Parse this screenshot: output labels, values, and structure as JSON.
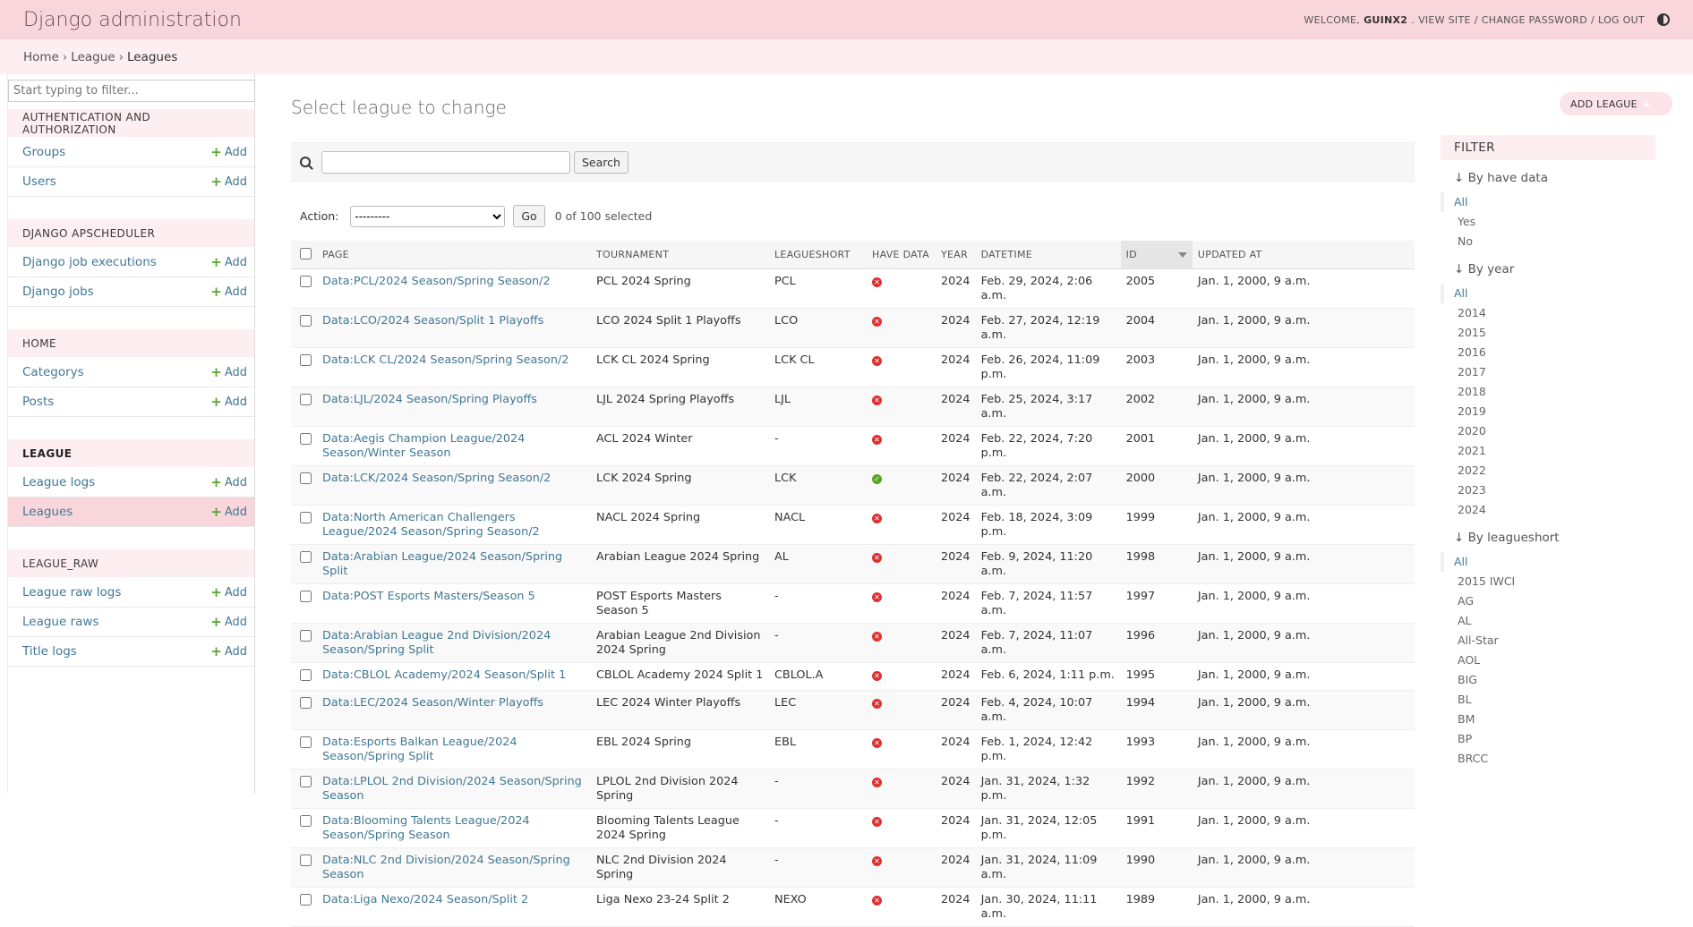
{
  "header": {
    "site_name": "Django administration",
    "welcome": "WELCOME,",
    "username": "GUINX2",
    "links": [
      "VIEW SITE",
      "CHANGE PASSWORD",
      "LOG OUT"
    ],
    "separator": "/"
  },
  "breadcrumbs": {
    "home": "Home",
    "app": "League",
    "current": "Leagues",
    "sep": "›"
  },
  "sidebar": {
    "filter_placeholder": "Start typing to filter...",
    "add_label": "Add",
    "apps": [
      {
        "caption": "AUTHENTICATION AND AUTHORIZATION",
        "models": [
          "Groups",
          "Users"
        ]
      },
      {
        "caption": "DJANGO APSCHEDULER",
        "models": [
          "Django job executions",
          "Django jobs"
        ]
      },
      {
        "caption": "HOME",
        "models": [
          "Categorys",
          "Posts"
        ]
      },
      {
        "caption": "LEAGUE",
        "models": [
          "League logs",
          "Leagues"
        ]
      },
      {
        "caption": "LEAGUE_RAW",
        "models": [
          "League raw logs",
          "League raws",
          "Title logs"
        ]
      }
    ]
  },
  "main": {
    "title": "Select league to change",
    "add_button": "ADD LEAGUE",
    "search_button": "Search",
    "action_label": "Action:",
    "action_selected": "---------",
    "go_button": "Go",
    "counter": "0 of 100 selected"
  },
  "table": {
    "columns": [
      "PAGE",
      "TOURNAMENT",
      "LEAGUESHORT",
      "HAVE DATA",
      "YEAR",
      "DATETIME",
      "ID",
      "UPDATED AT"
    ],
    "rows": [
      [
        "Data:PCL/2024 Season/Spring Season/2",
        "PCL 2024 Spring",
        "PCL",
        "no",
        "2024",
        "Feb. 29, 2024, 2:06 a.m.",
        "2005",
        "Jan. 1, 2000, 9 a.m."
      ],
      [
        "Data:LCO/2024 Season/Split 1 Playoffs",
        "LCO 2024 Split 1 Playoffs",
        "LCO",
        "no",
        "2024",
        "Feb. 27, 2024, 12:19 a.m.",
        "2004",
        "Jan. 1, 2000, 9 a.m."
      ],
      [
        "Data:LCK CL/2024 Season/Spring Season/2",
        "LCK CL 2024 Spring",
        "LCK CL",
        "no",
        "2024",
        "Feb. 26, 2024, 11:09 p.m.",
        "2003",
        "Jan. 1, 2000, 9 a.m."
      ],
      [
        "Data:LJL/2024 Season/Spring Playoffs",
        "LJL 2024 Spring Playoffs",
        "LJL",
        "no",
        "2024",
        "Feb. 25, 2024, 3:17 a.m.",
        "2002",
        "Jan. 1, 2000, 9 a.m."
      ],
      [
        "Data:Aegis Champion League/2024 Season/Winter Season",
        "ACL 2024 Winter",
        "-",
        "no",
        "2024",
        "Feb. 22, 2024, 7:20 p.m.",
        "2001",
        "Jan. 1, 2000, 9 a.m."
      ],
      [
        "Data:LCK/2024 Season/Spring Season/2",
        "LCK 2024 Spring",
        "LCK",
        "yes",
        "2024",
        "Feb. 22, 2024, 2:07 a.m.",
        "2000",
        "Jan. 1, 2000, 9 a.m."
      ],
      [
        "Data:North American Challengers League/2024 Season/Spring Season/2",
        "NACL 2024 Spring",
        "NACL",
        "no",
        "2024",
        "Feb. 18, 2024, 3:09 p.m.",
        "1999",
        "Jan. 1, 2000, 9 a.m."
      ],
      [
        "Data:Arabian League/2024 Season/Spring Split",
        "Arabian League 2024 Spring",
        "AL",
        "no",
        "2024",
        "Feb. 9, 2024, 11:20 a.m.",
        "1998",
        "Jan. 1, 2000, 9 a.m."
      ],
      [
        "Data:POST Esports Masters/Season 5",
        "POST Esports Masters Season 5",
        "-",
        "no",
        "2024",
        "Feb. 7, 2024, 11:57 a.m.",
        "1997",
        "Jan. 1, 2000, 9 a.m."
      ],
      [
        "Data:Arabian League 2nd Division/2024 Season/Spring Split",
        "Arabian League 2nd Division 2024 Spring",
        "-",
        "no",
        "2024",
        "Feb. 7, 2024, 11:07 a.m.",
        "1996",
        "Jan. 1, 2000, 9 a.m."
      ],
      [
        "Data:CBLOL Academy/2024 Season/Split 1",
        "CBLOL Academy 2024 Split 1",
        "CBLOL.A",
        "no",
        "2024",
        "Feb. 6, 2024, 1:11 p.m.",
        "1995",
        "Jan. 1, 2000, 9 a.m."
      ],
      [
        "Data:LEC/2024 Season/Winter Playoffs",
        "LEC 2024 Winter Playoffs",
        "LEC",
        "no",
        "2024",
        "Feb. 4, 2024, 10:07 a.m.",
        "1994",
        "Jan. 1, 2000, 9 a.m."
      ],
      [
        "Data:Esports Balkan League/2024 Season/Spring Split",
        "EBL 2024 Spring",
        "EBL",
        "no",
        "2024",
        "Feb. 1, 2024, 12:42 p.m.",
        "1993",
        "Jan. 1, 2000, 9 a.m."
      ],
      [
        "Data:LPLOL 2nd Division/2024 Season/Spring Season",
        "LPLOL 2nd Division 2024 Spring",
        "-",
        "no",
        "2024",
        "Jan. 31, 2024, 1:32 p.m.",
        "1992",
        "Jan. 1, 2000, 9 a.m."
      ],
      [
        "Data:Blooming Talents League/2024 Season/Spring Season",
        "Blooming Talents League 2024 Spring",
        "-",
        "no",
        "2024",
        "Jan. 31, 2024, 12:05 p.m.",
        "1991",
        "Jan. 1, 2000, 9 a.m."
      ],
      [
        "Data:NLC 2nd Division/2024 Season/Spring Season",
        "NLC 2nd Division 2024 Spring",
        "-",
        "no",
        "2024",
        "Jan. 31, 2024, 11:09 a.m.",
        "1990",
        "Jan. 1, 2000, 9 a.m."
      ],
      [
        "Data:Liga Nexo/2024 Season/Split 2",
        "Liga Nexo 23-24 Split 2",
        "NEXO",
        "no",
        "2024",
        "Jan. 30, 2024, 11:11 a.m.",
        "1989",
        "Jan. 1, 2000, 9 a.m."
      ]
    ]
  },
  "filter": {
    "title": "FILTER",
    "groups": [
      {
        "title": "↓ By have data",
        "options": [
          "All",
          "Yes",
          "No"
        ]
      },
      {
        "title": "↓ By year",
        "options": [
          "All",
          "2014",
          "2015",
          "2016",
          "2017",
          "2018",
          "2019",
          "2020",
          "2021",
          "2022",
          "2023",
          "2024"
        ]
      },
      {
        "title": "↓ By leagueshort",
        "options": [
          "All",
          "2015 IWCI",
          "AG",
          "AL",
          "All-Star",
          "AOL",
          "BIG",
          "BL",
          "BM",
          "BP",
          "BRCC"
        ]
      }
    ]
  },
  "colors": {
    "header_bg": "#f8d6dc",
    "breadcrumb_bg": "#fdeef1",
    "link": "#417893",
    "add_green": "#5aa72e",
    "error_red": "#dd3131",
    "success_green": "#56a620"
  }
}
